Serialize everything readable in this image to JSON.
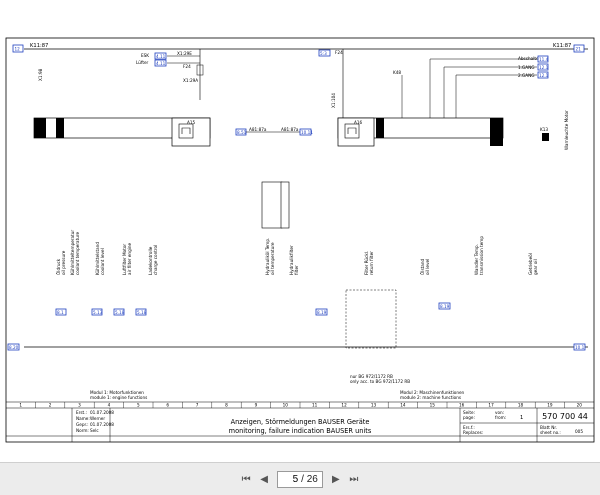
{
  "sheet": {
    "header_left_ref": "12",
    "header_left_label": "K11:87",
    "header_right_label": "K11:87",
    "header_right_ref": "21",
    "top_labels": {
      "esk": "ESK",
      "luefter": "Lüfter",
      "esk_ref": "4.11",
      "luefter_ref": "4.11",
      "x1_29e": "X1:29E",
      "f24_left": "F24",
      "f24_right": "F24",
      "x1_29a": "X1:29A",
      "ref_f24": "5:3",
      "x1_98": "X1:98",
      "x1_104": "X1:104",
      "abschalten": "Abschalten",
      "gang1": "1.GANG",
      "gang2": "2.GANG",
      "ref_abschalten": "11.4",
      "ref_gang1": "12.1",
      "ref_gang2": "12.1",
      "k48": "K48",
      "a15": "A15",
      "a16": "A16",
      "k13": "K13",
      "k13_vert": "Warnleuchte Motor"
    },
    "bus_labels": {
      "left_ref": "8.51",
      "left_net": "A81:87a",
      "right_net": "A81:87a",
      "right_ref": "10.11"
    },
    "left_sensors": [
      {
        "label": "Öldruck",
        "sub": "oil pressure"
      },
      {
        "label": "Kühlmitteltemperatur",
        "sub": "coolant temperature"
      },
      {
        "label": "Kühlmittelstand",
        "sub": "coolant level"
      },
      {
        "label": "Luftfilter Motor",
        "sub": "air filter engine"
      },
      {
        "label": "Ladekontrolle",
        "sub": "charge control"
      }
    ],
    "right_sensors": [
      {
        "label": "Hydrauliköl Temp.",
        "sub": "oil temperature"
      },
      {
        "label": "Hydraulikfilter",
        "sub": "filter"
      },
      {
        "label": "Filter Rückl.",
        "sub": "return filter"
      },
      {
        "label": "Ölstand",
        "sub": "oil level"
      },
      {
        "label": "Wandler Temp.",
        "sub": "transmission temp"
      },
      {
        "label": "Getriebeöl",
        "sub": "gear oil"
      }
    ],
    "left_bottom_refs": [
      "8.1",
      "5.13",
      "5.18",
      "5.18"
    ],
    "right_bottom_refs": [
      "8.19",
      "8.19"
    ],
    "left_page_ref": "8.20",
    "right_page_ref": "10.1",
    "bottom_notes": {
      "bg_label": "nur BG 972/1172 RB",
      "only_label": "only acc. to BG 972/1172 RB"
    },
    "module_left": {
      "line1": "Modul 1: Motorfunktionen",
      "line2": "module 1: engine functions"
    },
    "module_right": {
      "line1": "Modul 2: Maschinenfunktionen",
      "line2": "module 2: machine functions"
    },
    "grid_numbers": [
      "1",
      "2",
      "3",
      "4",
      "5",
      "6",
      "7",
      "8",
      "9",
      "10",
      "11",
      "12",
      "13",
      "14",
      "15",
      "16",
      "17",
      "18",
      "19",
      "20"
    ],
    "title_block": {
      "erst_label": "Erst.:",
      "erst_date": "01.07.2008",
      "name_label": "Name:",
      "name_value": "Werner",
      "gepr_label": "Gepr.:",
      "gepr_date": "01.07.2008",
      "norm_label": "Norm:",
      "norm_value": "Selc",
      "title_de": "Anzeigen, Störmeldungen BAUSER Geräte",
      "title_en": "monitoring, failure indication BAUSER units",
      "seite_label": "Seite:",
      "page_of_label": "page:",
      "von_label": "von:",
      "from_label": "from:",
      "sheet_val": "1",
      "drawing_no": "570 700 44",
      "ersatz_label": "Ers.f.:",
      "replaces_label": "Replaces:",
      "blatt_label": "Blatt Nr.",
      "sheet_no_label": "sheet no.:",
      "sheet_no": "005"
    }
  },
  "viewer": {
    "current_page": "5",
    "total_pages": "/ 26"
  }
}
